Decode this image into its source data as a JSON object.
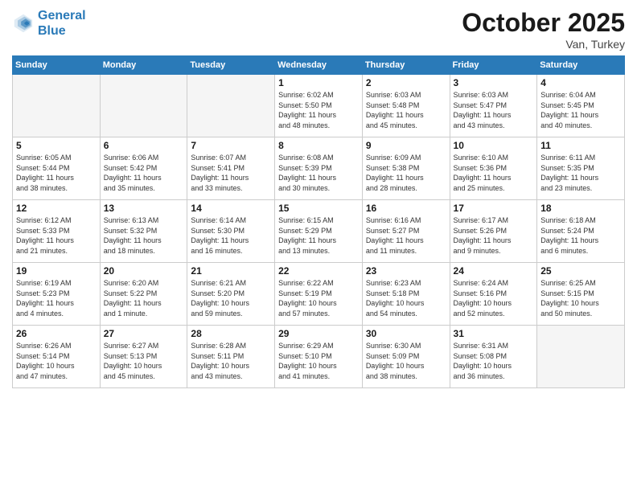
{
  "header": {
    "logo_line1": "General",
    "logo_line2": "Blue",
    "month": "October 2025",
    "location": "Van, Turkey"
  },
  "days_of_week": [
    "Sunday",
    "Monday",
    "Tuesday",
    "Wednesday",
    "Thursday",
    "Friday",
    "Saturday"
  ],
  "weeks": [
    [
      {
        "day": "",
        "info": ""
      },
      {
        "day": "",
        "info": ""
      },
      {
        "day": "",
        "info": ""
      },
      {
        "day": "1",
        "info": "Sunrise: 6:02 AM\nSunset: 5:50 PM\nDaylight: 11 hours\nand 48 minutes."
      },
      {
        "day": "2",
        "info": "Sunrise: 6:03 AM\nSunset: 5:48 PM\nDaylight: 11 hours\nand 45 minutes."
      },
      {
        "day": "3",
        "info": "Sunrise: 6:03 AM\nSunset: 5:47 PM\nDaylight: 11 hours\nand 43 minutes."
      },
      {
        "day": "4",
        "info": "Sunrise: 6:04 AM\nSunset: 5:45 PM\nDaylight: 11 hours\nand 40 minutes."
      }
    ],
    [
      {
        "day": "5",
        "info": "Sunrise: 6:05 AM\nSunset: 5:44 PM\nDaylight: 11 hours\nand 38 minutes."
      },
      {
        "day": "6",
        "info": "Sunrise: 6:06 AM\nSunset: 5:42 PM\nDaylight: 11 hours\nand 35 minutes."
      },
      {
        "day": "7",
        "info": "Sunrise: 6:07 AM\nSunset: 5:41 PM\nDaylight: 11 hours\nand 33 minutes."
      },
      {
        "day": "8",
        "info": "Sunrise: 6:08 AM\nSunset: 5:39 PM\nDaylight: 11 hours\nand 30 minutes."
      },
      {
        "day": "9",
        "info": "Sunrise: 6:09 AM\nSunset: 5:38 PM\nDaylight: 11 hours\nand 28 minutes."
      },
      {
        "day": "10",
        "info": "Sunrise: 6:10 AM\nSunset: 5:36 PM\nDaylight: 11 hours\nand 25 minutes."
      },
      {
        "day": "11",
        "info": "Sunrise: 6:11 AM\nSunset: 5:35 PM\nDaylight: 11 hours\nand 23 minutes."
      }
    ],
    [
      {
        "day": "12",
        "info": "Sunrise: 6:12 AM\nSunset: 5:33 PM\nDaylight: 11 hours\nand 21 minutes."
      },
      {
        "day": "13",
        "info": "Sunrise: 6:13 AM\nSunset: 5:32 PM\nDaylight: 11 hours\nand 18 minutes."
      },
      {
        "day": "14",
        "info": "Sunrise: 6:14 AM\nSunset: 5:30 PM\nDaylight: 11 hours\nand 16 minutes."
      },
      {
        "day": "15",
        "info": "Sunrise: 6:15 AM\nSunset: 5:29 PM\nDaylight: 11 hours\nand 13 minutes."
      },
      {
        "day": "16",
        "info": "Sunrise: 6:16 AM\nSunset: 5:27 PM\nDaylight: 11 hours\nand 11 minutes."
      },
      {
        "day": "17",
        "info": "Sunrise: 6:17 AM\nSunset: 5:26 PM\nDaylight: 11 hours\nand 9 minutes."
      },
      {
        "day": "18",
        "info": "Sunrise: 6:18 AM\nSunset: 5:24 PM\nDaylight: 11 hours\nand 6 minutes."
      }
    ],
    [
      {
        "day": "19",
        "info": "Sunrise: 6:19 AM\nSunset: 5:23 PM\nDaylight: 11 hours\nand 4 minutes."
      },
      {
        "day": "20",
        "info": "Sunrise: 6:20 AM\nSunset: 5:22 PM\nDaylight: 11 hours\nand 1 minute."
      },
      {
        "day": "21",
        "info": "Sunrise: 6:21 AM\nSunset: 5:20 PM\nDaylight: 10 hours\nand 59 minutes."
      },
      {
        "day": "22",
        "info": "Sunrise: 6:22 AM\nSunset: 5:19 PM\nDaylight: 10 hours\nand 57 minutes."
      },
      {
        "day": "23",
        "info": "Sunrise: 6:23 AM\nSunset: 5:18 PM\nDaylight: 10 hours\nand 54 minutes."
      },
      {
        "day": "24",
        "info": "Sunrise: 6:24 AM\nSunset: 5:16 PM\nDaylight: 10 hours\nand 52 minutes."
      },
      {
        "day": "25",
        "info": "Sunrise: 6:25 AM\nSunset: 5:15 PM\nDaylight: 10 hours\nand 50 minutes."
      }
    ],
    [
      {
        "day": "26",
        "info": "Sunrise: 6:26 AM\nSunset: 5:14 PM\nDaylight: 10 hours\nand 47 minutes."
      },
      {
        "day": "27",
        "info": "Sunrise: 6:27 AM\nSunset: 5:13 PM\nDaylight: 10 hours\nand 45 minutes."
      },
      {
        "day": "28",
        "info": "Sunrise: 6:28 AM\nSunset: 5:11 PM\nDaylight: 10 hours\nand 43 minutes."
      },
      {
        "day": "29",
        "info": "Sunrise: 6:29 AM\nSunset: 5:10 PM\nDaylight: 10 hours\nand 41 minutes."
      },
      {
        "day": "30",
        "info": "Sunrise: 6:30 AM\nSunset: 5:09 PM\nDaylight: 10 hours\nand 38 minutes."
      },
      {
        "day": "31",
        "info": "Sunrise: 6:31 AM\nSunset: 5:08 PM\nDaylight: 10 hours\nand 36 minutes."
      },
      {
        "day": "",
        "info": ""
      }
    ]
  ]
}
